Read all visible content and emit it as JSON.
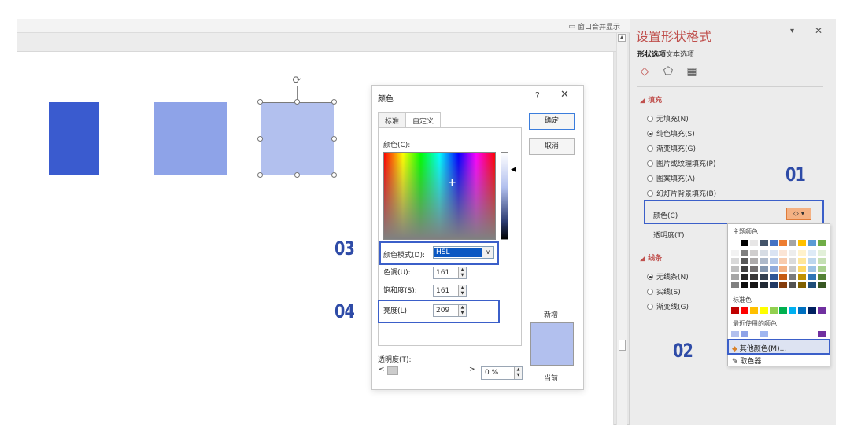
{
  "toolbar": {
    "merge_window": "窗口合并显示"
  },
  "dialog": {
    "title": "颜色",
    "help": "?",
    "close": "✕",
    "tabs": [
      "标准",
      "自定义"
    ],
    "colors_label": "颜色(C):",
    "mode_label": "颜色模式(D):",
    "mode_value": "HSL",
    "hue_label": "色调(U):",
    "hue_value": "161",
    "sat_label": "饱和度(S):",
    "sat_value": "161",
    "lum_label": "亮度(L):",
    "lum_value": "209",
    "ok": "确定",
    "cancel": "取消",
    "new_label": "新增",
    "current_label": "当前",
    "transparency_label": "透明度(T):",
    "transparency_value": "0 %",
    "slider_left": "<",
    "slider_right": ">"
  },
  "panel": {
    "title": "设置形状格式",
    "tab_shape": "形状选项",
    "tab_text": "文本选项",
    "fill_heading": "填充",
    "fill_options": [
      "无填充(N)",
      "纯色填充(S)",
      "渐变填充(G)",
      "图片或纹理填充(P)",
      "图案填充(A)",
      "幻灯片背景填充(B)"
    ],
    "color_label": "颜色(C)",
    "transparency_label": "透明度(T)",
    "line_heading": "线条",
    "line_options": [
      "无线条(N)",
      "实线(S)",
      "渐变线(G)"
    ]
  },
  "palette": {
    "theme_heading": "主题颜色",
    "standard_heading": "标准色",
    "recent_heading": "最近使用的颜色",
    "more_colors": "其他颜色(M)...",
    "eyedropper": "取色器"
  },
  "annotations": {
    "n01": "01",
    "n02": "02",
    "n03": "03",
    "n04": "04"
  },
  "colors": {
    "shape1": "#3a5bcf",
    "shape2": "#8ea3e8",
    "shape3": "#b2c0ee",
    "accent": "#c0504d",
    "highlight": "#3b5fc9"
  }
}
